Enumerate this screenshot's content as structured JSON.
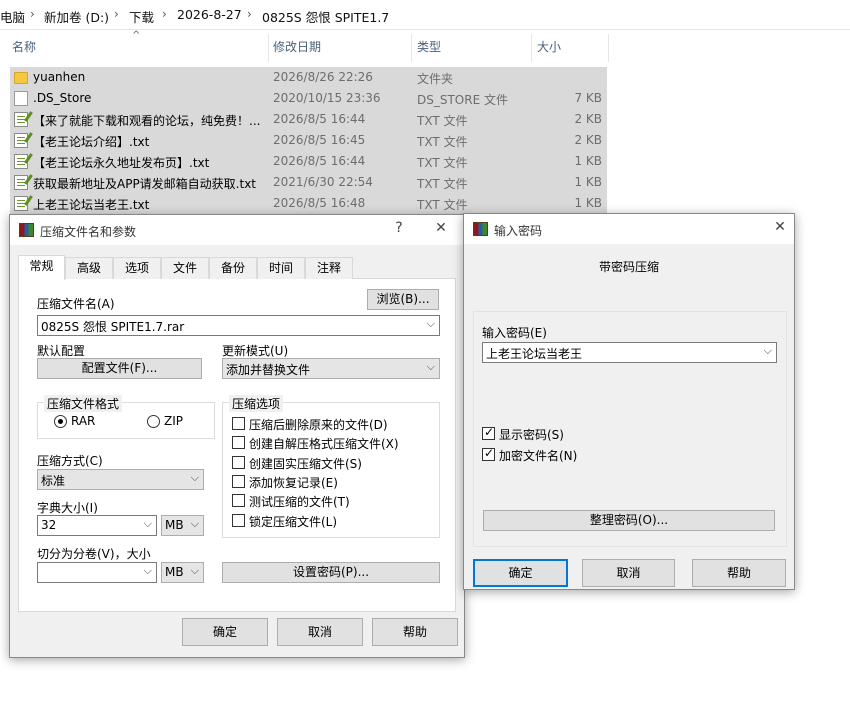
{
  "explorer": {
    "breadcrumb": [
      "电脑",
      "新加卷 (D:)",
      "下载",
      "2026-8-27",
      "0825S 怨恨 SPITE1.7"
    ],
    "columns": {
      "name": "名称",
      "modified": "修改日期",
      "type": "类型",
      "size": "大小"
    },
    "files": [
      {
        "icon": "folder-icon",
        "name": "yuanhen",
        "date": "2026/8/26 22:26",
        "type": "文件夹",
        "size": ""
      },
      {
        "icon": "file-icon",
        "name": ".DS_Store",
        "date": "2020/10/15 23:36",
        "type": "DS_STORE 文件",
        "size": "7 KB"
      },
      {
        "icon": "txt-file-icon",
        "name": "【来了就能下载和观看的论坛，纯免费！...",
        "date": "2026/8/5 16:44",
        "type": "TXT 文件",
        "size": "2 KB"
      },
      {
        "icon": "txt-file-icon",
        "name": "【老王论坛介绍】.txt",
        "date": "2026/8/5 16:45",
        "type": "TXT 文件",
        "size": "2 KB"
      },
      {
        "icon": "txt-file-icon",
        "name": "【老王论坛永久地址发布页】.txt",
        "date": "2026/8/5 16:44",
        "type": "TXT 文件",
        "size": "1 KB"
      },
      {
        "icon": "txt-file-icon",
        "name": "获取最新地址及APP请发邮箱自动获取.txt",
        "date": "2021/6/30 22:54",
        "type": "TXT 文件",
        "size": "1 KB"
      },
      {
        "icon": "txt-file-icon",
        "name": "上老王论坛当老王.txt",
        "date": "2026/8/5 16:48",
        "type": "TXT 文件",
        "size": "1 KB"
      }
    ]
  },
  "archive_dialog": {
    "title": "压缩文件名和参数",
    "help_glyph": "?",
    "close_glyph": "✕",
    "tabs": [
      "常规",
      "高级",
      "选项",
      "文件",
      "备份",
      "时间",
      "注释"
    ],
    "archive_name_label": "压缩文件名(A)",
    "browse_button": "浏览(B)...",
    "archive_name_value": "0825S 怨恨 SPITE1.7.rar",
    "profile_label": "默认配置",
    "profile_button": "配置文件(F)...",
    "update_mode_label": "更新模式(U)",
    "update_mode_value": "添加并替换文件",
    "format_group": "压缩文件格式",
    "format_rar": "RAR",
    "format_zip": "ZIP",
    "method_label": "压缩方式(C)",
    "method_value": "标准",
    "dict_label": "字典大小(I)",
    "dict_value": "32",
    "dict_unit": "MB",
    "split_label": "切分为分卷(V)，大小",
    "split_value": "",
    "split_unit": "MB",
    "options_group": "压缩选项",
    "options": [
      {
        "label": "压缩后删除原来的文件(D)",
        "checked": false
      },
      {
        "label": "创建自解压格式压缩文件(X)",
        "checked": false
      },
      {
        "label": "创建固实压缩文件(S)",
        "checked": false
      },
      {
        "label": "添加恢复记录(E)",
        "checked": false
      },
      {
        "label": "测试压缩的文件(T)",
        "checked": false
      },
      {
        "label": "锁定压缩文件(L)",
        "checked": false
      }
    ],
    "set_password_button": "设置密码(P)...",
    "ok_button": "确定",
    "cancel_button": "取消",
    "help_button": "帮助"
  },
  "password_dialog": {
    "title": "输入密码",
    "close_glyph": "✕",
    "heading": "带密码压缩",
    "password_label": "输入密码(E)",
    "password_value": "上老王论坛当老王",
    "show_password": {
      "label": "显示密码(S)",
      "checked": true
    },
    "encrypt_names": {
      "label": "加密文件名(N)",
      "checked": true
    },
    "organize_button": "整理密码(O)...",
    "ok_button": "确定",
    "cancel_button": "取消",
    "help_button": "帮助"
  }
}
